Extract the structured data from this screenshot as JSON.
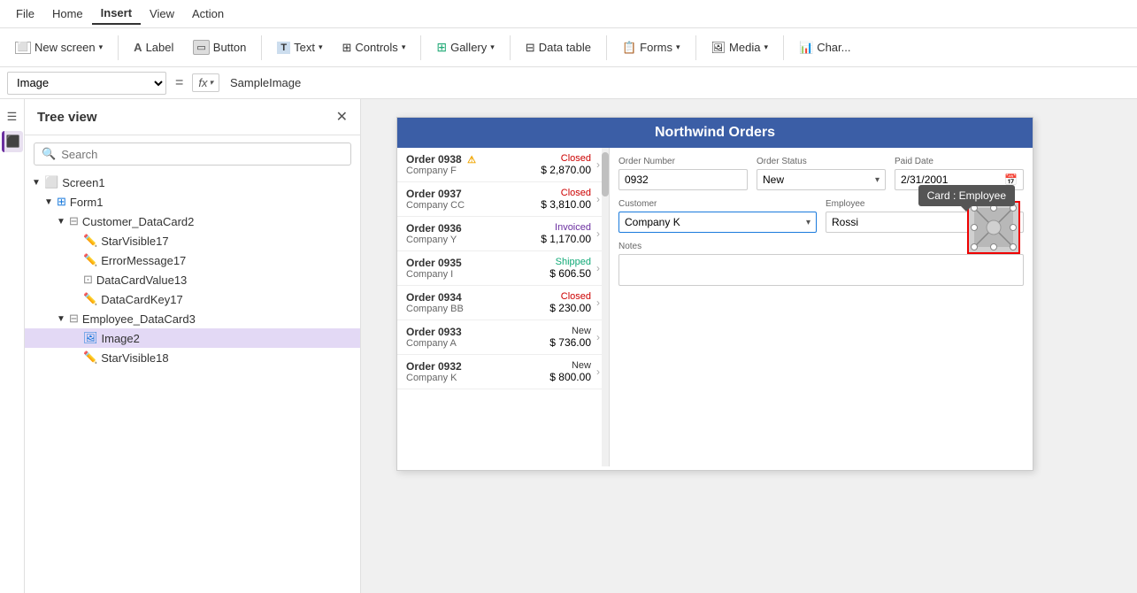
{
  "menu": {
    "items": [
      "File",
      "Home",
      "Insert",
      "View",
      "Action"
    ],
    "active": "Insert"
  },
  "toolbar": {
    "new_screen": "New screen",
    "label": "Label",
    "button": "Button",
    "text": "Text",
    "controls": "Controls",
    "gallery": "Gallery",
    "data_table": "Data table",
    "forms": "Forms",
    "media": "Media",
    "charts": "Char..."
  },
  "formula_bar": {
    "selected": "Image",
    "eq": "=",
    "fx": "fx",
    "value": "SampleImage"
  },
  "tree_view": {
    "title": "Tree view",
    "search_placeholder": "Search",
    "items": [
      {
        "id": "screen1",
        "label": "Screen1",
        "indent": 0,
        "type": "screen",
        "expand": "▼"
      },
      {
        "id": "form1",
        "label": "Form1",
        "indent": 1,
        "type": "form",
        "expand": "▼"
      },
      {
        "id": "customer_dc2",
        "label": "Customer_DataCard2",
        "indent": 2,
        "type": "datacard",
        "expand": "▼"
      },
      {
        "id": "starvisible17",
        "label": "StarVisible17",
        "indent": 3,
        "type": "pencil",
        "expand": ""
      },
      {
        "id": "errormessage17",
        "label": "ErrorMessage17",
        "indent": 3,
        "type": "pencil",
        "expand": ""
      },
      {
        "id": "datacardvalue13",
        "label": "DataCardValue13",
        "indent": 3,
        "type": "dotbox",
        "expand": ""
      },
      {
        "id": "datacardkey17",
        "label": "DataCardKey17",
        "indent": 3,
        "type": "pencil",
        "expand": ""
      },
      {
        "id": "employee_dc3",
        "label": "Employee_DataCard3",
        "indent": 2,
        "type": "datacard",
        "expand": "▼"
      },
      {
        "id": "image2",
        "label": "Image2",
        "indent": 3,
        "type": "image",
        "expand": "",
        "selected": true
      },
      {
        "id": "starvisible18",
        "label": "StarVisible18",
        "indent": 3,
        "type": "pencil",
        "expand": ""
      }
    ]
  },
  "app": {
    "title": "Northwind Orders",
    "orders": [
      {
        "number": "Order 0938",
        "company": "Company F",
        "status": "Closed",
        "amount": "$ 2,870.00",
        "warn": true
      },
      {
        "number": "Order 0937",
        "company": "Company CC",
        "status": "Closed",
        "amount": "$ 3,810.00",
        "warn": false
      },
      {
        "number": "Order 0936",
        "company": "Company Y",
        "status": "Invoiced",
        "amount": "$ 1,170.00",
        "warn": false
      },
      {
        "number": "Order 0935",
        "company": "Company I",
        "status": "Shipped",
        "amount": "$ 606.50",
        "warn": false
      },
      {
        "number": "Order 0934",
        "company": "Company BB",
        "status": "Closed",
        "amount": "$ 230.00",
        "warn": false
      },
      {
        "number": "Order 0933",
        "company": "Company A",
        "status": "New",
        "amount": "$ 736.00",
        "warn": false
      },
      {
        "number": "Order 0932",
        "company": "Company K",
        "status": "New",
        "amount": "$ 800.00",
        "warn": false
      }
    ],
    "detail": {
      "order_number_label": "Order Number",
      "order_number_value": "0932",
      "order_status_label": "Order Status",
      "order_status_value": "New",
      "paid_date_label": "Paid Date",
      "paid_date_value": "2/31/2001",
      "customer_label": "Customer",
      "customer_value": "Company K",
      "employee_label": "Employee",
      "employee_value": "Rossi",
      "notes_label": "Notes",
      "notes_value": ""
    },
    "tooltip": "Card : Employee"
  }
}
